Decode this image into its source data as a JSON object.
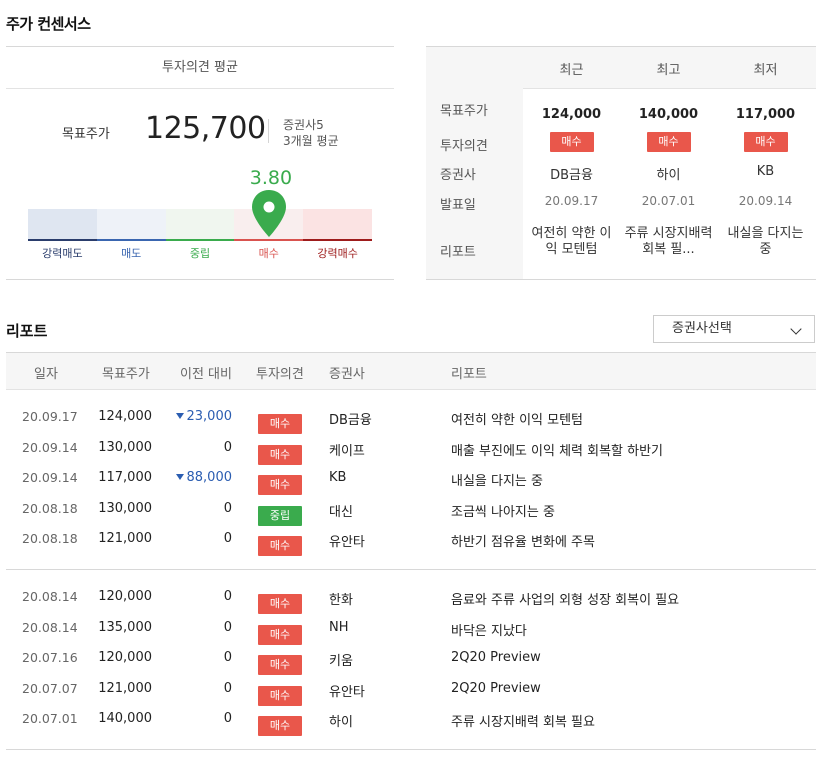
{
  "consensus": {
    "title": "주가 컨센서스",
    "avg_header": "투자의견 평균",
    "target_price_label": "목표주가",
    "target_price": "125,700",
    "firms_count": "증권사5",
    "period": "3개월 평균",
    "score": "3.80",
    "score_value": 3.8,
    "gauge_labels": [
      "강력매도",
      "매도",
      "중립",
      "매수",
      "강력매수"
    ],
    "gauge_label_colors": [
      "#2a3d6c",
      "#3a66b0",
      "#3aab4d",
      "#d9534f",
      "#9e1c1c"
    ]
  },
  "compare": {
    "headers": [
      "최근",
      "최고",
      "최저"
    ],
    "row_labels": [
      "목표주가",
      "투자의견",
      "증권사",
      "발표일",
      "리포트"
    ],
    "columns": [
      {
        "target": "124,000",
        "opinion": "매수",
        "firm": "DB금융",
        "date": "20.09.17",
        "report": "여전히 약한 이익 모텐텀"
      },
      {
        "target": "140,000",
        "opinion": "매수",
        "firm": "하이",
        "date": "20.07.01",
        "report": "주류 시장지배력 회복 필..."
      },
      {
        "target": "117,000",
        "opinion": "매수",
        "firm": "KB",
        "date": "20.09.14",
        "report": "내실을 다지는 중"
      }
    ]
  },
  "reports": {
    "title": "리포트",
    "select_label": "증권사선택",
    "headers": [
      "일자",
      "목표주가",
      "이전 대비",
      "투자의견",
      "증권사",
      "리포트"
    ],
    "rows": [
      {
        "date": "20.09.17",
        "target": "124,000",
        "change": "23,000",
        "down": true,
        "opinion": "매수",
        "type": "buy",
        "firm": "DB금융",
        "report": "여전히 약한 이익 모텐텀"
      },
      {
        "date": "20.09.14",
        "target": "130,000",
        "change": "0",
        "down": false,
        "opinion": "매수",
        "type": "buy",
        "firm": "케이프",
        "report": "매출 부진에도 이익 체력 회복할 하반기"
      },
      {
        "date": "20.09.14",
        "target": "117,000",
        "change": "88,000",
        "down": true,
        "opinion": "매수",
        "type": "buy",
        "firm": "KB",
        "report": "내실을 다지는 중"
      },
      {
        "date": "20.08.18",
        "target": "130,000",
        "change": "0",
        "down": false,
        "opinion": "중립",
        "type": "hold",
        "firm": "대신",
        "report": "조금씩 나아지는 중"
      },
      {
        "date": "20.08.18",
        "target": "121,000",
        "change": "0",
        "down": false,
        "opinion": "매수",
        "type": "buy",
        "firm": "유안타",
        "report": "하반기 점유율 변화에 주목"
      },
      {
        "date": "20.08.14",
        "target": "120,000",
        "change": "0",
        "down": false,
        "opinion": "매수",
        "type": "buy",
        "firm": "한화",
        "report": "음료와 주류 사업의 외형 성장 회복이 필요"
      },
      {
        "date": "20.08.14",
        "target": "135,000",
        "change": "0",
        "down": false,
        "opinion": "매수",
        "type": "buy",
        "firm": "NH",
        "report": "바닥은 지났다"
      },
      {
        "date": "20.07.16",
        "target": "120,000",
        "change": "0",
        "down": false,
        "opinion": "매수",
        "type": "buy",
        "firm": "키움",
        "report": "2Q20 Preview"
      },
      {
        "date": "20.07.07",
        "target": "121,000",
        "change": "0",
        "down": false,
        "opinion": "매수",
        "type": "buy",
        "firm": "유안타",
        "report": "2Q20 Preview"
      },
      {
        "date": "20.07.01",
        "target": "140,000",
        "change": "0",
        "down": false,
        "opinion": "매수",
        "type": "buy",
        "firm": "하이",
        "report": "주류 시장지배력 회복 필요"
      }
    ]
  }
}
